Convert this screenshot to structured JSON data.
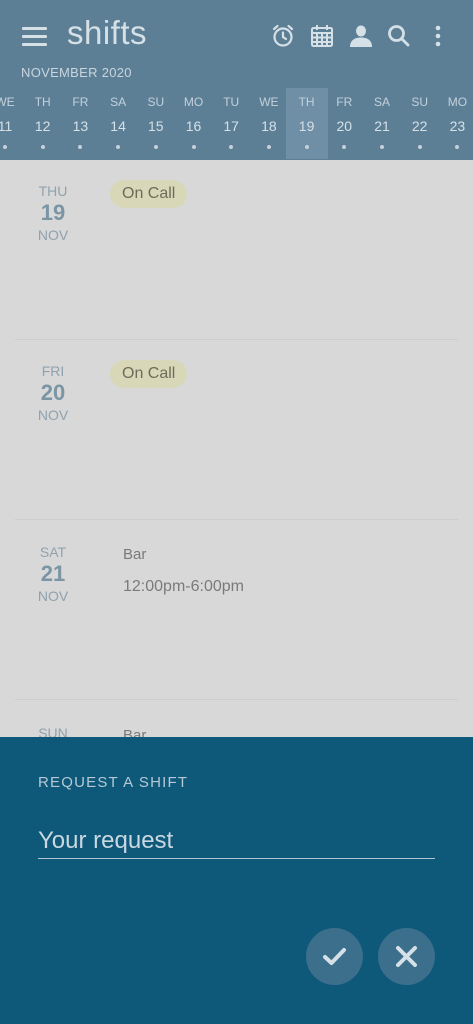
{
  "app": {
    "title": "shifts"
  },
  "toolbar": {
    "icons": [
      "menu-icon",
      "alarm-clock-icon",
      "calendar-icon",
      "person-icon",
      "search-icon",
      "more-vert-icon"
    ]
  },
  "calendar": {
    "month_label": "NOVEMBER 2020",
    "days": [
      {
        "dow": "WE",
        "num": "11",
        "selected": false
      },
      {
        "dow": "TH",
        "num": "12",
        "selected": false
      },
      {
        "dow": "FR",
        "num": "13",
        "selected": false
      },
      {
        "dow": "SA",
        "num": "14",
        "selected": false
      },
      {
        "dow": "SU",
        "num": "15",
        "selected": false
      },
      {
        "dow": "MO",
        "num": "16",
        "selected": false
      },
      {
        "dow": "TU",
        "num": "17",
        "selected": false
      },
      {
        "dow": "WE",
        "num": "18",
        "selected": false
      },
      {
        "dow": "TH",
        "num": "19",
        "selected": true
      },
      {
        "dow": "FR",
        "num": "20",
        "selected": false
      },
      {
        "dow": "SA",
        "num": "21",
        "selected": false
      },
      {
        "dow": "SU",
        "num": "22",
        "selected": false
      },
      {
        "dow": "MO",
        "num": "23",
        "selected": false
      }
    ]
  },
  "schedule": [
    {
      "dow": "THU",
      "day": "19",
      "month": "NOV",
      "badge": "On Call"
    },
    {
      "dow": "FRI",
      "day": "20",
      "month": "NOV",
      "badge": "On Call"
    },
    {
      "dow": "SAT",
      "day": "21",
      "month": "NOV",
      "shift": "Bar",
      "time": "12:00pm-6:00pm"
    },
    {
      "dow": "SUN",
      "shift": "Bar"
    }
  ],
  "request_sheet": {
    "title": "REQUEST A SHIFT",
    "input_placeholder": "Your request",
    "confirm_icon": "check-icon",
    "cancel_icon": "close-icon"
  },
  "colors": {
    "header_bg": "#5d7f96",
    "sheet_bg": "#0e587a",
    "list_bg": "#d8d8d8",
    "badge_bg": "#d8d8b8"
  }
}
